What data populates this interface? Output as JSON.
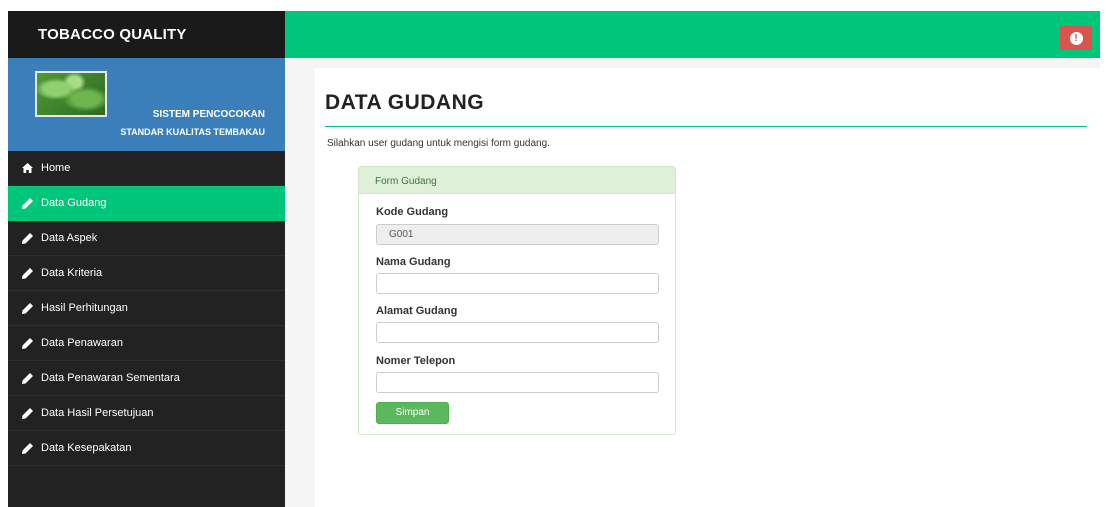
{
  "brand": {
    "title": "TOBACCO QUALITY"
  },
  "profile": {
    "line1": "SISTEM PENCOCOKAN",
    "line2": "STANDAR KUALITAS TEMBAKAU"
  },
  "sidebar": {
    "items": [
      {
        "label": "Home",
        "icon": "home-icon"
      },
      {
        "label": "Data Gudang",
        "icon": "pencil-icon",
        "active": true
      },
      {
        "label": "Data Aspek",
        "icon": "pencil-icon"
      },
      {
        "label": "Data Kriteria",
        "icon": "pencil-icon"
      },
      {
        "label": "Hasil Perhitungan",
        "icon": "pencil-icon"
      },
      {
        "label": "Data Penawaran",
        "icon": "pencil-icon"
      },
      {
        "label": "Data Penawaran Sementara",
        "icon": "pencil-icon"
      },
      {
        "label": "Data Hasil Persetujuan",
        "icon": "pencil-icon"
      },
      {
        "label": "Data Kesepakatan",
        "icon": "pencil-icon"
      }
    ]
  },
  "topbar": {
    "alert_icon": "exclamation-icon"
  },
  "page": {
    "title": "DATA GUDANG",
    "description": "Silahkan user gudang untuk mengisi form gudang."
  },
  "form": {
    "heading": "Form Gudang",
    "fields": {
      "kode": {
        "label": "Kode Gudang",
        "value": "G001"
      },
      "nama": {
        "label": "Nama Gudang",
        "value": ""
      },
      "alamat": {
        "label": "Alamat Gudang",
        "value": ""
      },
      "telepon": {
        "label": "Nomer Telepon",
        "value": ""
      }
    },
    "submit_label": "Simpan"
  },
  "colors": {
    "accent": "#00c67a",
    "sidebar": "#222222",
    "profile": "#3a7fb9",
    "danger": "#d9534f",
    "success": "#5cb85c"
  }
}
